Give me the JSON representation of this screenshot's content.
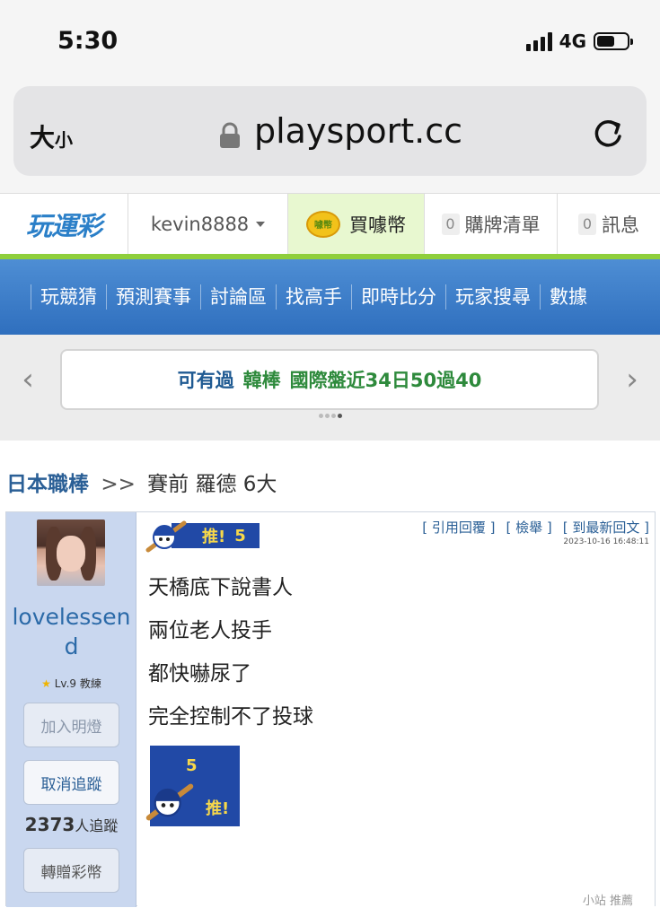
{
  "status_bar": {
    "time": "5:30",
    "network": "4G"
  },
  "browser": {
    "size_label": "大",
    "size_label_small": "小",
    "host": "playsport.cc"
  },
  "site_nav": {
    "logo": "玩運彩",
    "username": "kevin8888",
    "buy_coins": "買噱幣",
    "coin_text": "噱幣",
    "cart_count": "0",
    "cart_label": "購牌清單",
    "msg_count": "0",
    "msg_label": "訊息"
  },
  "menu": [
    "玩競猜",
    "預測賽事",
    "討論區",
    "找高手",
    "即時比分",
    "玩家搜尋",
    "數據"
  ],
  "carousel": {
    "lead": "可有過",
    "league": "韓棒",
    "text": "國際盤近34日50過40",
    "dots": 4,
    "active_dot": 3
  },
  "breadcrumb": {
    "board": "日本職棒",
    "sep": ">>",
    "title": "賽前 羅德 6大"
  },
  "post": {
    "author": {
      "name": "lovelessend",
      "level": "Lv.9 教練",
      "add_light": "加入明燈",
      "unfollow": "取消追蹤",
      "followers_count": "2373",
      "followers_label": "人追蹤",
      "gift": "轉贈彩幣"
    },
    "push_badge": {
      "label": "推!",
      "count": "5"
    },
    "actions": [
      "[ 引用回覆 ]",
      "[ 檢舉 ]",
      "[ 到最新回文 ]"
    ],
    "timestamp": "2023-10-16 16:48:11",
    "lines": [
      "天橋底下說書人",
      "兩位老人投手",
      "都快嚇尿了",
      "完全控制不了投球"
    ],
    "push_box": {
      "count": "5",
      "label": "推!"
    },
    "footer_note": "小站 推薦"
  },
  "colors": {
    "menu_blue": "#2f6fbe",
    "accent_green": "#8fcf3c",
    "link_blue": "#2a5f96",
    "push_blue": "#2149a6",
    "push_yellow": "#f7d84a"
  }
}
